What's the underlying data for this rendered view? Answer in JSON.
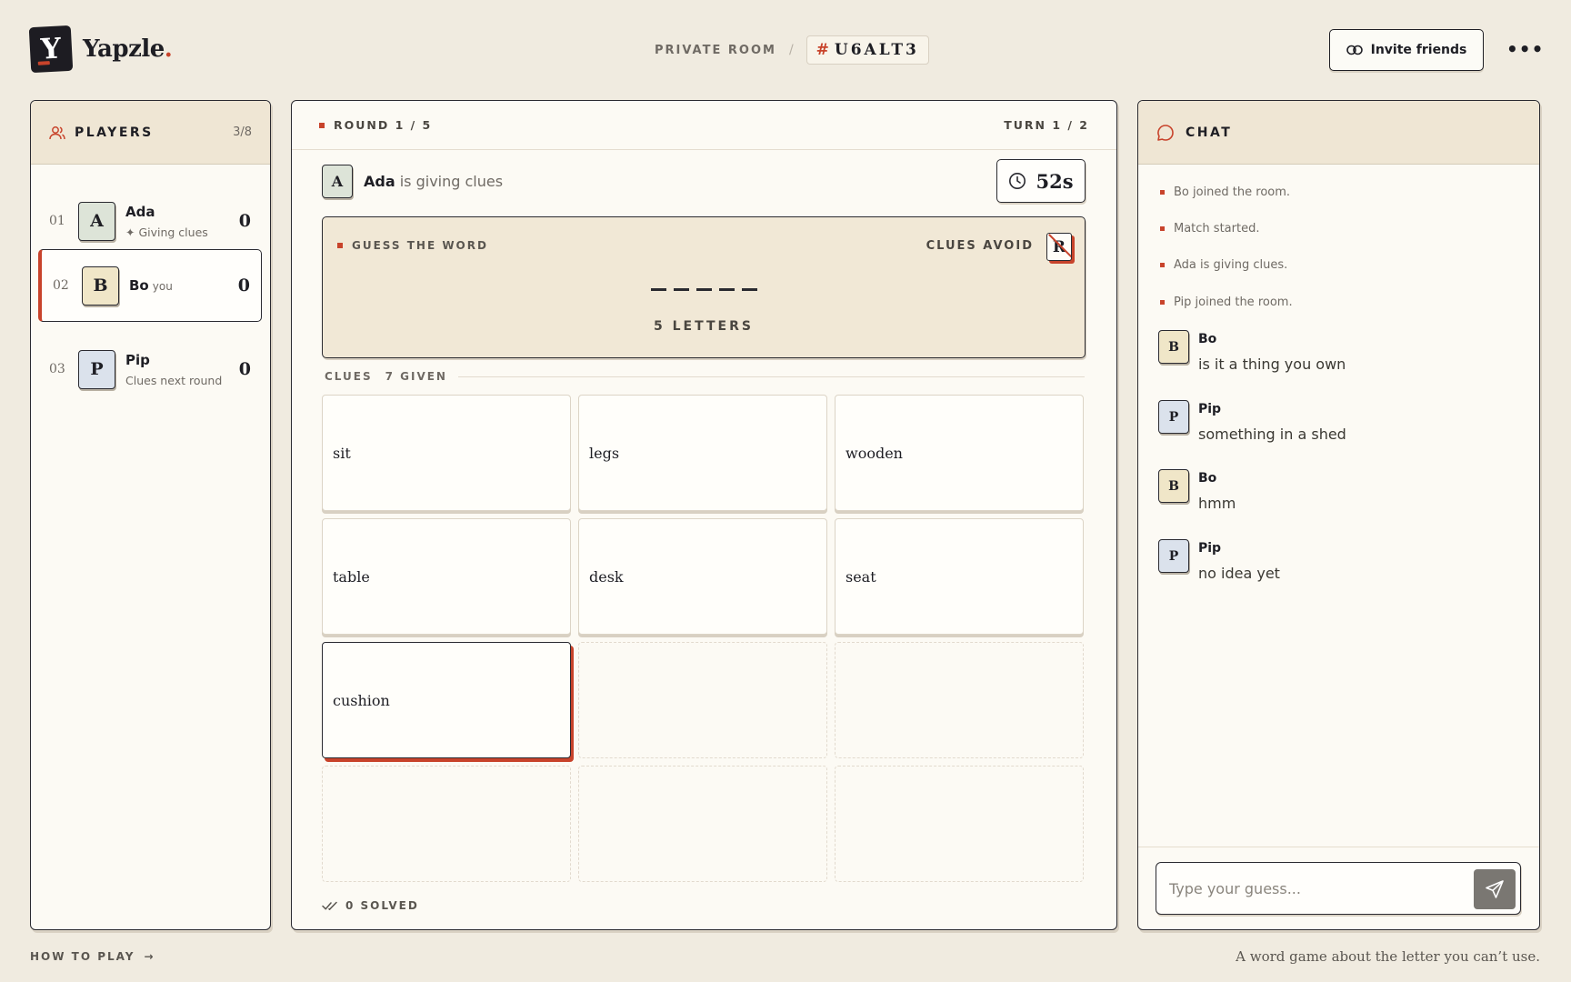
{
  "app": {
    "name": "Yapzle",
    "logo_letter": "Y",
    "accent": "#c8432b"
  },
  "header": {
    "room_label": "PRIVATE ROOM",
    "room_sep": "/",
    "room_hash": "#",
    "room_code": "U6ALT3",
    "invite_label": "Invite friends",
    "more_label": "•••"
  },
  "players": {
    "title": "PLAYERS",
    "count": "3/8",
    "list": [
      {
        "num": "01",
        "initial": "A",
        "name": "Ada",
        "tag": "",
        "sub": "✦ Giving clues",
        "score": "0"
      },
      {
        "num": "02",
        "initial": "B",
        "name": "Bo",
        "tag": "you",
        "sub": "",
        "score": "0"
      },
      {
        "num": "03",
        "initial": "P",
        "name": "Pip",
        "tag": "",
        "sub": "Clues next round",
        "score": "0"
      }
    ]
  },
  "game": {
    "round": "ROUND 1 / 5",
    "turn": "TURN 1 / 2",
    "giver_initial": "A",
    "giver_name": "Ada",
    "giver_suffix": " is giving clues",
    "timer": "52s",
    "guess_label": "GUESS THE WORD",
    "avoid_label": "CLUES AVOID",
    "avoid_letter": "R",
    "letters_label": "5 LETTERS",
    "clues_label": "CLUES",
    "clues_given": "7 GIVEN",
    "clues": [
      "sit",
      "legs",
      "wooden",
      "table",
      "desk",
      "seat",
      "cushion"
    ],
    "solved_label": "0 SOLVED"
  },
  "chat": {
    "title": "CHAT",
    "system": [
      "Bo joined the room.",
      "Match started.",
      "Ada is giving clues.",
      "Pip joined the room."
    ],
    "messages": [
      {
        "initial": "B",
        "name": "Bo",
        "text": "is it a thing you own"
      },
      {
        "initial": "P",
        "name": "Pip",
        "text": "something in a shed"
      },
      {
        "initial": "B",
        "name": "Bo",
        "text": "hmm"
      },
      {
        "initial": "P",
        "name": "Pip",
        "text": "no idea yet"
      }
    ],
    "input_placeholder": "Type your guess..."
  },
  "footer": {
    "how_to_play": "HOW TO PLAY",
    "arrow": "→",
    "tagline": "A word game about the letter you can’t use."
  }
}
